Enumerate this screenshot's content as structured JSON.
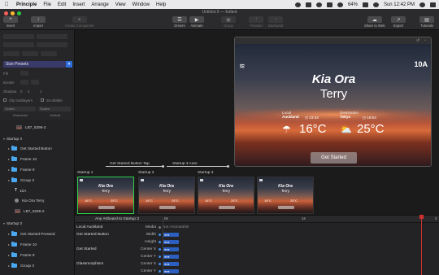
{
  "menubar": {
    "app": "Principle",
    "items": [
      "File",
      "Edit",
      "Insert",
      "Arrange",
      "View",
      "Window",
      "Help"
    ],
    "battery": "64%",
    "clock": "Sun 12:42 PM"
  },
  "toolbar": {
    "title": "Untitled 6 — Edited",
    "insert": "Insert",
    "import": "Import",
    "create_component": "Create Component",
    "drivers": "Drivers",
    "animate": "Animate",
    "group": "Group",
    "forward": "Forward",
    "backward": "Backward",
    "share_to_web": "Share to Web",
    "export": "Export",
    "tutorials": "Tutorials"
  },
  "inspector": {
    "preset": "Size Presets",
    "fill": "Fill",
    "border": "Border",
    "shadow": "Shadow",
    "shadow_values": [
      "0",
      "4",
      "1"
    ],
    "clip": "Clip Sublayers",
    "scrollable": "Scrollable",
    "horizontal": "Horizontal",
    "vertical": "Vertical",
    "horiz_value": "Scales",
    "vert_value": "Scales"
  },
  "layers": [
    {
      "indent": 1,
      "type": "image",
      "label": "LB7_5296-2"
    },
    {
      "indent": 0,
      "type": "group",
      "label": "Startup 3",
      "expanded": true
    },
    {
      "indent": 1,
      "type": "folder",
      "label": "Get Started Button"
    },
    {
      "indent": 1,
      "type": "folder",
      "label": "Frame 10"
    },
    {
      "indent": 1,
      "type": "folder",
      "label": "Frame 9"
    },
    {
      "indent": 1,
      "type": "folder",
      "label": "Group 3"
    },
    {
      "indent": 1,
      "type": "text",
      "label": "10A"
    },
    {
      "indent": 1,
      "type": "circle",
      "label": "Kia Ora Terry"
    },
    {
      "indent": 1,
      "type": "image",
      "label": "LB7_5296-2"
    },
    {
      "indent": 0,
      "type": "group",
      "label": "Startup 3",
      "expanded": true
    },
    {
      "indent": 1,
      "type": "folder",
      "label": "Get Started Pressed"
    },
    {
      "indent": 1,
      "type": "folder",
      "label": "Frame 10"
    },
    {
      "indent": 1,
      "type": "folder",
      "label": "Frame 9"
    },
    {
      "indent": 1,
      "type": "folder",
      "label": "Group 3"
    }
  ],
  "viewer": {
    "tag": "10A",
    "greeting": "Kia Ora",
    "name": "Terry",
    "local_caption": "Local",
    "local_city": "Auckland",
    "local_time": "23:34",
    "local_temp": "16°C",
    "dest_caption": "Destination",
    "dest_city": "Tokyo",
    "dest_time": "19:54",
    "dest_temp": "25°C",
    "button": "Get Started"
  },
  "flow": {
    "tap_label": "Get Started Button Tap",
    "auto_label": "Startup 3 Auto"
  },
  "artboards": [
    {
      "title": "Startup 1",
      "greeting": "Kia Ora",
      "name": "Terry",
      "t1": "16°C",
      "t2": "25°C"
    },
    {
      "title": "Startup 3",
      "greeting": "Kia Ora",
      "name": "Terry",
      "t1": "16°C",
      "t2": "25°C"
    },
    {
      "title": "Startup 3",
      "greeting": "Kia Ora",
      "name": "Terry",
      "t1": "16°C",
      "t2": "25°C"
    },
    {
      "title": "",
      "greeting": "Kia Ora",
      "name": "Terry",
      "t1": "16°C",
      "t2": "25°C"
    }
  ],
  "timeline": {
    "header": "Any Artboard to Startup 3",
    "t0": "0s",
    "t1": "1s",
    "t2": "2",
    "rows": [
      {
        "object": "Local Auckland",
        "property": "Media",
        "value": "Not Animatable",
        "animatable": false
      },
      {
        "object": "Get Started Button",
        "property": "Width",
        "value": "",
        "animatable": true
      },
      {
        "object": "",
        "property": "Height",
        "value": "",
        "animatable": true
      },
      {
        "object": "Get Started",
        "property": "Center X",
        "value": "",
        "animatable": true
      },
      {
        "object": "",
        "property": "Center Y",
        "value": "",
        "animatable": true
      },
      {
        "object": "Glassmorphism",
        "property": "Center X",
        "value": "",
        "animatable": true
      },
      {
        "object": "",
        "property": "Center Y",
        "value": "",
        "animatable": true
      }
    ]
  }
}
